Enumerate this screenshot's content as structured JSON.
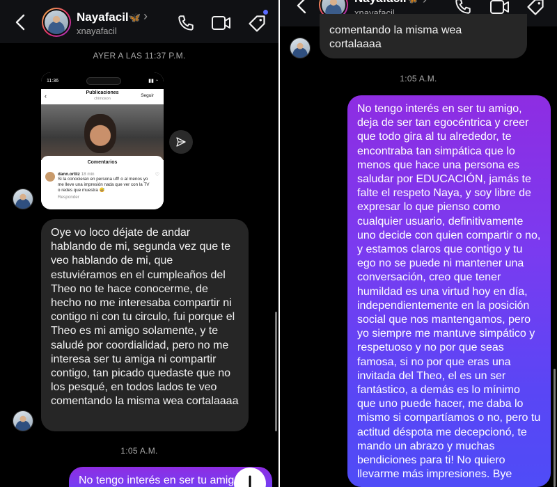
{
  "contact": {
    "name": "Nayafacil",
    "name_emoji": "🦋",
    "username": "xnayafacil"
  },
  "left": {
    "timestamp": "AYER A LAS 11:37 P.M.",
    "timestamp2": "1:05 A.M.",
    "shared_post": {
      "status_time": "11:36",
      "title": "Publicaciones",
      "title_sub": "chimoson",
      "follow_label": "Seguir",
      "comments_heading": "Comentarios",
      "comment_user": "dann.ortiiz",
      "comment_age": "18 min",
      "comment_text": "Si la conocieran en persona uff! o al menos yo me lleve una impresión nada que ver con la TV o redes que muestra 😅",
      "reply_label": "Responder"
    },
    "message_in": "Oye vo loco déjate de andar hablando de mi, segunda vez que te veo hablando de mi, que estuviéramos en el cumpleaños del Theo no te hace conocerme, de hecho no me interesaba compartir ni contigo ni con tu circulo, fui porque el Theo es mi amigo solamente, y te saludé por coordialidad, pero no me interesa ser tu amiga ni compartir contigo, tan picado quedaste que no los pesqué, en todos lados te veo comentando la misma wea cortalaaaa",
    "message_out_preview": "No tengo interés en ser tu amigo,"
  },
  "right": {
    "prev_tail_1": "comentando la misma wea",
    "prev_tail_2": "cortalaaaa",
    "timestamp": "1:05 A.M.",
    "message_out": "No tengo interés en ser tu amigo, deja de ser tan egocéntrica y creer que todo gira al tu alrededor, te encontraba tan simpática que lo menos que hace una persona es saludar por EDUCACIÓN, jamás te falte el respeto Naya, y soy libre de expresar lo que pienso como cualquier usuario, definitivamente uno decide con quien compartir o no, y estamos claros que contigo y tu ego no se puede ni mantener una conversación, creo que tener humildad es una virtud hoy en día, independientemente en la posición social que nos mantengamos, pero yo siempre me mantuve simpático y respetuoso y no por que seas famosa, si no por que eras una invitada del Theo, el es un ser fantástico, a demás es lo mínimo que uno puede hacer, me daba lo mismo si compartíamos o no, pero tu actitud déspota me decepcionó, te mando un abrazo y muchas bendiciones para ti! No quiero llevarme más impresiones. Bye"
  },
  "icons": [
    "back-icon",
    "phone-icon",
    "video-icon",
    "tag-icon",
    "send-icon"
  ],
  "colors": {
    "bubble_in": "#262626",
    "bubble_out_top": "#8e2de2",
    "bubble_out_bottom": "#4f4cf7",
    "notification_dot": "#5b6cff"
  }
}
